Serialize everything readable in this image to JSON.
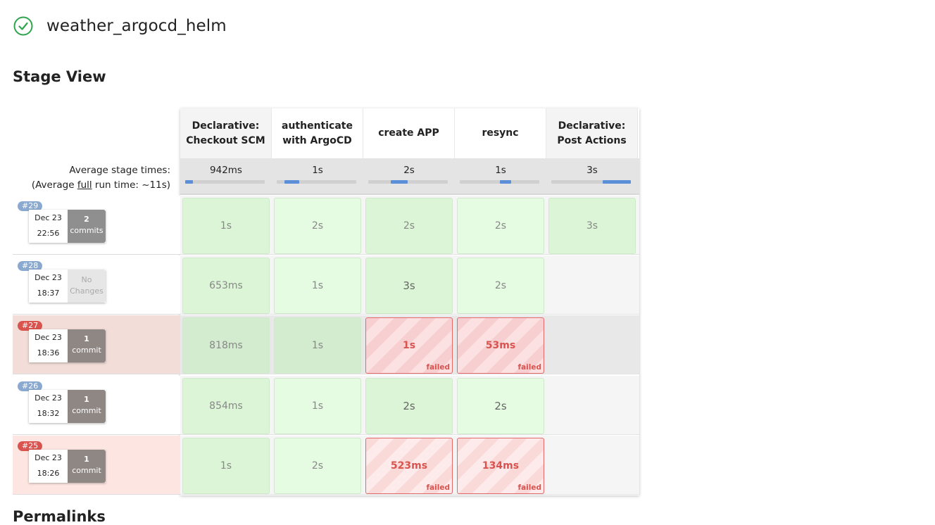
{
  "job": {
    "title": "weather_argocd_helm",
    "status_icon": "check-circle-icon",
    "status_color": "#2ea44f"
  },
  "stage_view": {
    "heading": "Stage View"
  },
  "section_below": {
    "heading": "Permalinks"
  },
  "average": {
    "line1": "Average stage times:",
    "line2_prefix": "(Average ",
    "line2_link": "full",
    "line2_suffix": " run time: ~11s)"
  },
  "stages": [
    {
      "line1": "Declarative:",
      "line2": "Checkout SCM",
      "avg": "942ms",
      "bar_start": 0.0,
      "bar_fraction": 0.1
    },
    {
      "line1": "authenticate",
      "line2": "with ArgoCD",
      "avg": "1s",
      "bar_start": 0.1,
      "bar_fraction": 0.18
    },
    {
      "line1": "create APP",
      "line2": "",
      "avg": "2s",
      "bar_start": 0.28,
      "bar_fraction": 0.22
    },
    {
      "line1": "resync",
      "line2": "",
      "avg": "1s",
      "bar_start": 0.5,
      "bar_fraction": 0.15
    },
    {
      "line1": "Declarative:",
      "line2": "Post Actions",
      "avg": "3s",
      "bar_start": 0.65,
      "bar_fraction": 0.35
    }
  ],
  "builds": [
    {
      "number": "#29",
      "date": "Dec 23",
      "time": "22:56",
      "commits_num": "2",
      "commits_label": "commits",
      "status": "success",
      "cells": [
        {
          "text": "1s",
          "state": "success"
        },
        {
          "text": "2s",
          "state": "success"
        },
        {
          "text": "2s",
          "state": "success"
        },
        {
          "text": "2s",
          "state": "success"
        },
        {
          "text": "3s",
          "state": "success"
        }
      ]
    },
    {
      "number": "#28",
      "date": "Dec 23",
      "time": "18:37",
      "commits_num": "",
      "commits_label": "No Changes",
      "status": "success",
      "cells": [
        {
          "text": "653ms",
          "state": "success"
        },
        {
          "text": "1s",
          "state": "success"
        },
        {
          "text": "3s",
          "state": "success"
        },
        {
          "text": "2s",
          "state": "success"
        },
        {
          "text": "",
          "state": "empty"
        }
      ]
    },
    {
      "number": "#27",
      "date": "Dec 23",
      "time": "18:36",
      "commits_num": "1",
      "commits_label": "commit",
      "status": "failed",
      "cells": [
        {
          "text": "818ms",
          "state": "success"
        },
        {
          "text": "1s",
          "state": "success"
        },
        {
          "text": "1s",
          "state": "failed",
          "tag": "failed"
        },
        {
          "text": "53ms",
          "state": "failed",
          "tag": "failed"
        },
        {
          "text": "",
          "state": "empty"
        }
      ]
    },
    {
      "number": "#26",
      "date": "Dec 23",
      "time": "18:32",
      "commits_num": "1",
      "commits_label": "commit",
      "status": "success",
      "cells": [
        {
          "text": "854ms",
          "state": "success"
        },
        {
          "text": "1s",
          "state": "success"
        },
        {
          "text": "2s",
          "state": "success"
        },
        {
          "text": "2s",
          "state": "success"
        },
        {
          "text": "",
          "state": "empty"
        }
      ]
    },
    {
      "number": "#25",
      "date": "Dec 23",
      "time": "18:26",
      "commits_num": "1",
      "commits_label": "commit",
      "status": "failed",
      "cells": [
        {
          "text": "1s",
          "state": "success"
        },
        {
          "text": "2s",
          "state": "success"
        },
        {
          "text": "523ms",
          "state": "failed",
          "tag": "failed"
        },
        {
          "text": "134ms",
          "state": "failed",
          "tag": "failed"
        },
        {
          "text": "",
          "state": "empty"
        }
      ]
    }
  ]
}
